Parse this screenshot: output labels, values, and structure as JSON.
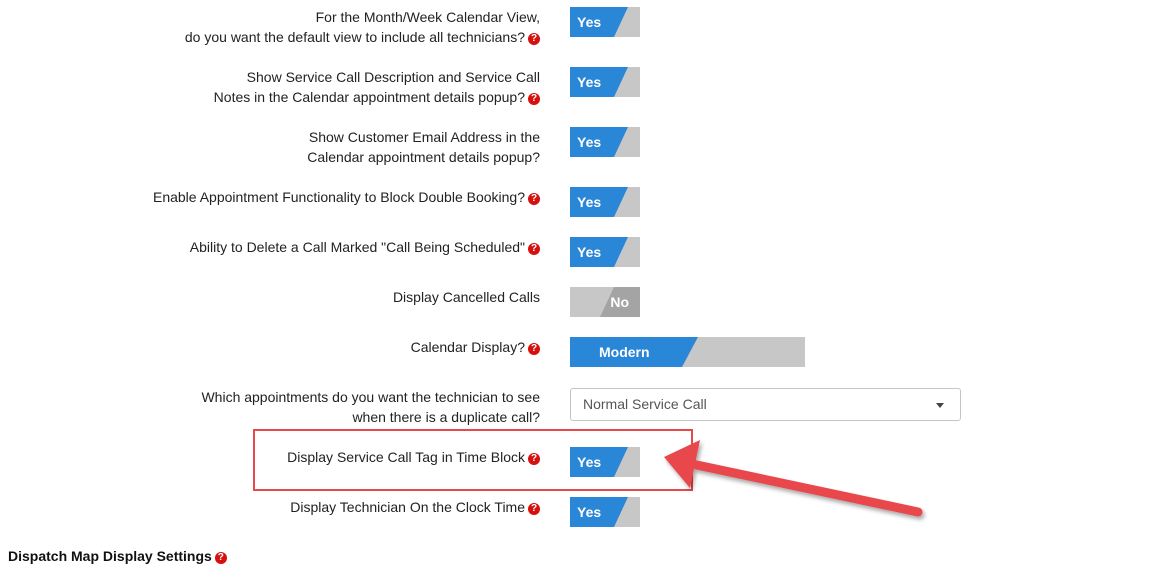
{
  "settings": [
    {
      "line1": "For the Month/Week Calendar View,",
      "line2": "do you want the default view to include all technicians?",
      "help": true,
      "value": "Yes"
    },
    {
      "line1": "Show Service Call Description and Service Call",
      "line2": "Notes in the Calendar appointment details popup?",
      "help": true,
      "value": "Yes"
    },
    {
      "line1": "Show Customer Email Address in the",
      "line2": "Calendar appointment details popup?",
      "help": false,
      "value": "Yes"
    },
    {
      "line1": "Enable Appointment Functionality to Block Double Booking?",
      "help": true,
      "value": "Yes"
    },
    {
      "line1": "Ability to Delete a Call Marked \"Call Being Scheduled\"",
      "help": true,
      "value": "Yes"
    },
    {
      "line1": "Display Cancelled Calls",
      "help": false,
      "value": "No"
    },
    {
      "line1": "Calendar Display?",
      "help": true,
      "value": "Modern"
    },
    {
      "line1": "Which appointments do you want the technician to see",
      "line2": "when there is a duplicate call?",
      "help": false,
      "value": "Normal Service Call"
    },
    {
      "line1": "Display Service Call Tag in Time Block",
      "help": true,
      "value": "Yes"
    },
    {
      "line1": "Display Technician On the Clock Time",
      "help": true,
      "value": "Yes"
    }
  ],
  "section_title": "Dispatch Map Display Settings",
  "help_glyph": "?",
  "colors": {
    "accent": "#2a86d6",
    "toggle_off": "#c7c7c7",
    "help": "#d60f0f",
    "annotation": "#e8474c"
  }
}
